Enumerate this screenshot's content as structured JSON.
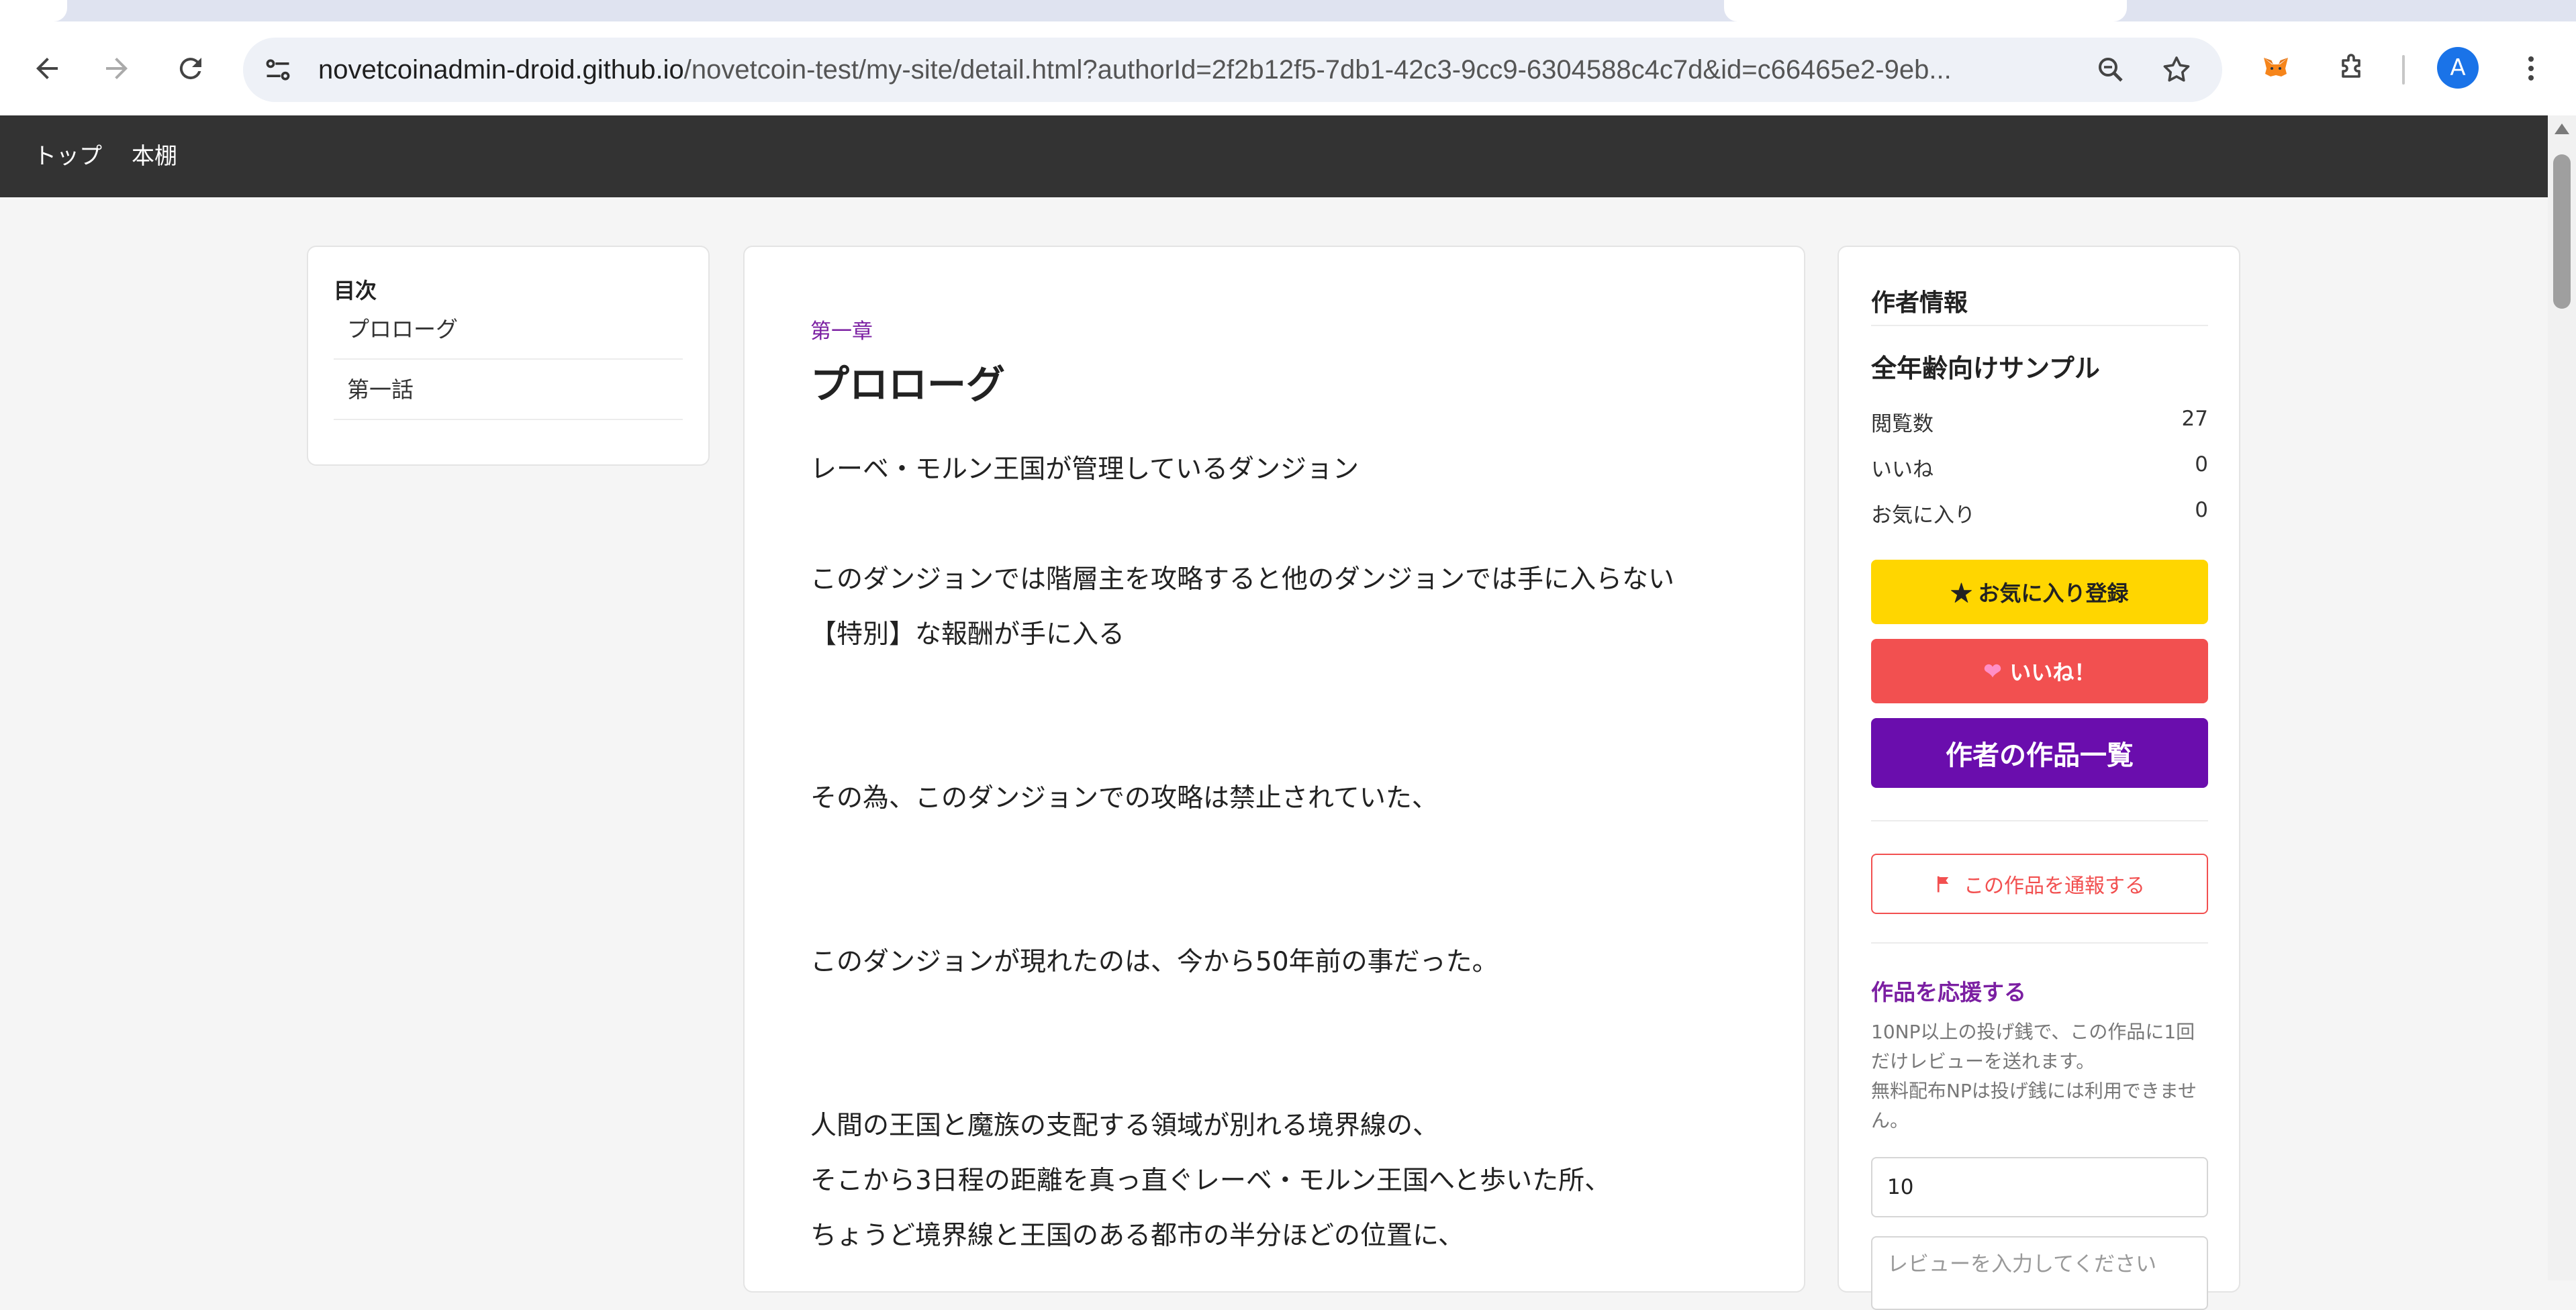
{
  "browser": {
    "url_host": "novetcoinadmin-droid.github.io",
    "url_path": "/novetcoin-test/my-site/detail.html?authorId=2f2b12f5-7db1-42c3-9cc9-6304588c4c7d&id=c66465e2-9eb...",
    "avatar_letter": "A"
  },
  "site_nav": {
    "top": "トップ",
    "bookshelf": "本棚"
  },
  "toc": {
    "title": "目次",
    "items": [
      "プロローグ",
      "第一話"
    ]
  },
  "content": {
    "chapter": "第一章",
    "title": "プロローグ",
    "lines": [
      "レーベ・モルン王国が管理しているダンジョン",
      "このダンジョンでは階層主を攻略すると他のダンジョンでは手に入らない",
      "【特別】な報酬が手に入る",
      "その為、このダンジョンでの攻略は禁止されていた、",
      "このダンジョンが現れたのは、今から50年前の事だった。",
      "人間の王国と魔族の支配する領域が別れる境界線の、",
      "そこから3日程の距離を真っ直ぐレーベ・モルン王国へと歩いた所、",
      "ちょうど境界線と王国のある都市の半分ほどの位置に、"
    ]
  },
  "author_info": {
    "heading": "作者情報",
    "work_title": "全年齢向けサンプル",
    "stats": [
      {
        "label": "閲覧数",
        "value": "27"
      },
      {
        "label": "いいね",
        "value": "0"
      },
      {
        "label": "お気に入り",
        "value": "0"
      }
    ],
    "favorite_button": "★ お気に入り登録",
    "like_button": "いいね！",
    "works_button": "作者の作品一覧",
    "report_button": "この作品を通報する"
  },
  "support": {
    "title": "作品を応援する",
    "desc_1": "10NP以上の投げ銭で、この作品に1回だけレビューを送れます。",
    "desc_2": "無料配布NPは投げ銭には利用できません。",
    "amount_value": "10",
    "review_placeholder": "レビューを入力してください"
  },
  "colors": {
    "nav_bg": "#333333",
    "favorite": "#ffd600",
    "like": "#f25050",
    "works": "#6a0dad",
    "accent_purple": "#7b1fa2"
  }
}
